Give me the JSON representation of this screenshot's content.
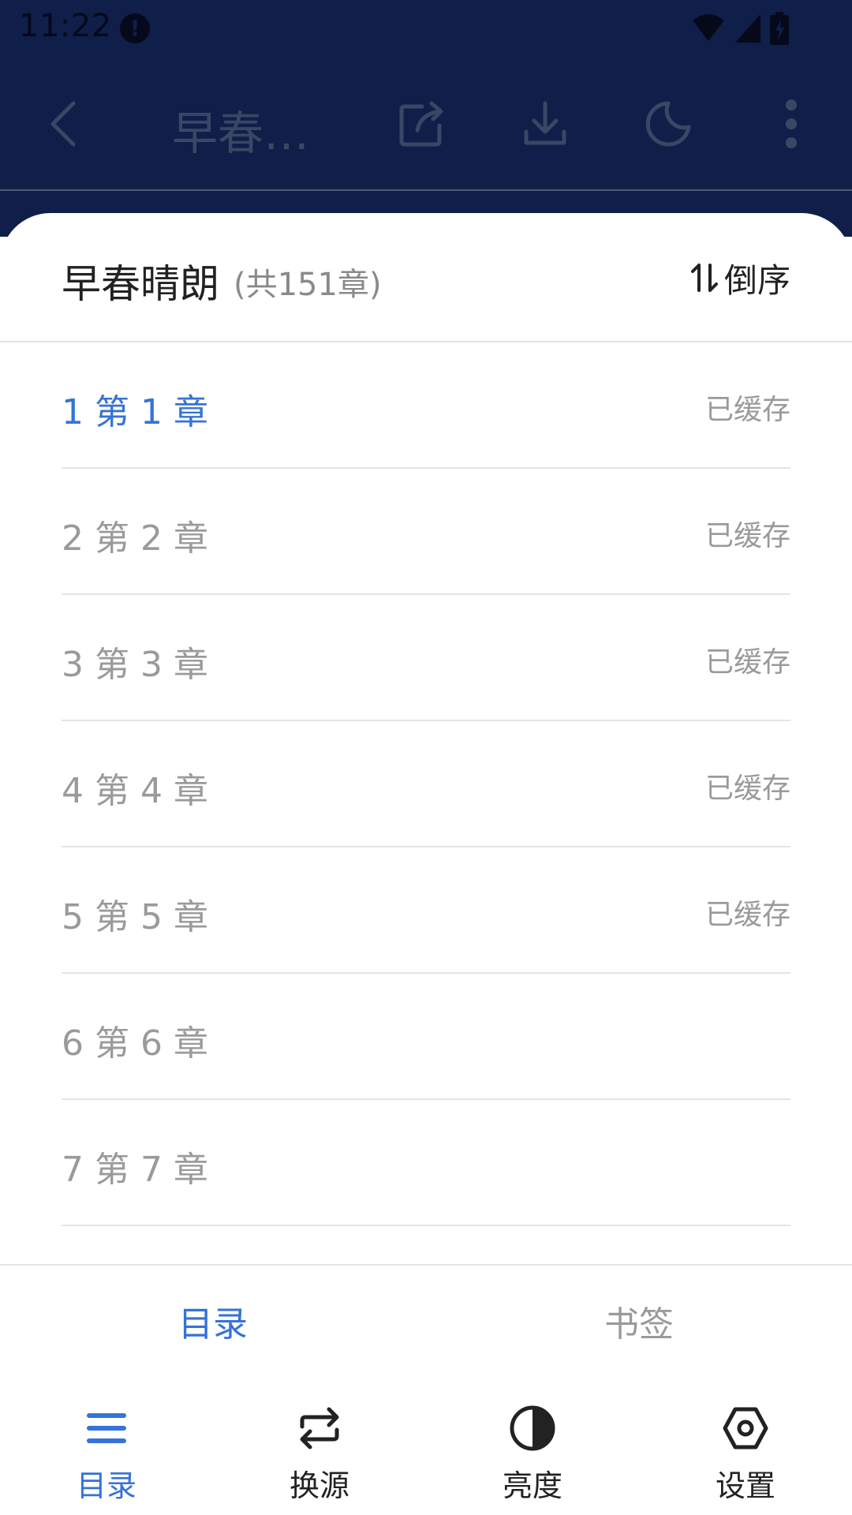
{
  "status_bar": {
    "time": "11:22"
  },
  "toolbar": {
    "title": "早春…",
    "icons": [
      "back-icon",
      "share-icon",
      "download-icon",
      "night-mode-icon",
      "more-icon"
    ]
  },
  "sheet": {
    "title": "早春晴朗",
    "count": "(共151章)",
    "sort_label": "倒序"
  },
  "chapters": [
    {
      "title": "1 第 1 章",
      "status": "已缓存"
    },
    {
      "title": "2 第 2 章",
      "status": "已缓存"
    },
    {
      "title": "3 第 3 章",
      "status": "已缓存"
    },
    {
      "title": "4 第 4 章",
      "status": "已缓存"
    },
    {
      "title": "5 第 5 章",
      "status": "已缓存"
    },
    {
      "title": "6 第 6 章",
      "status": ""
    },
    {
      "title": "7 第 7 章",
      "status": ""
    }
  ],
  "tabs": {
    "contents": "目录",
    "bookmarks": "书签"
  },
  "bottom_nav": {
    "contents": "目录",
    "change_source": "换源",
    "brightness": "亮度",
    "settings": "设置"
  },
  "colors": {
    "accent": "#3573d6",
    "scrim": "#0f1f4a"
  }
}
